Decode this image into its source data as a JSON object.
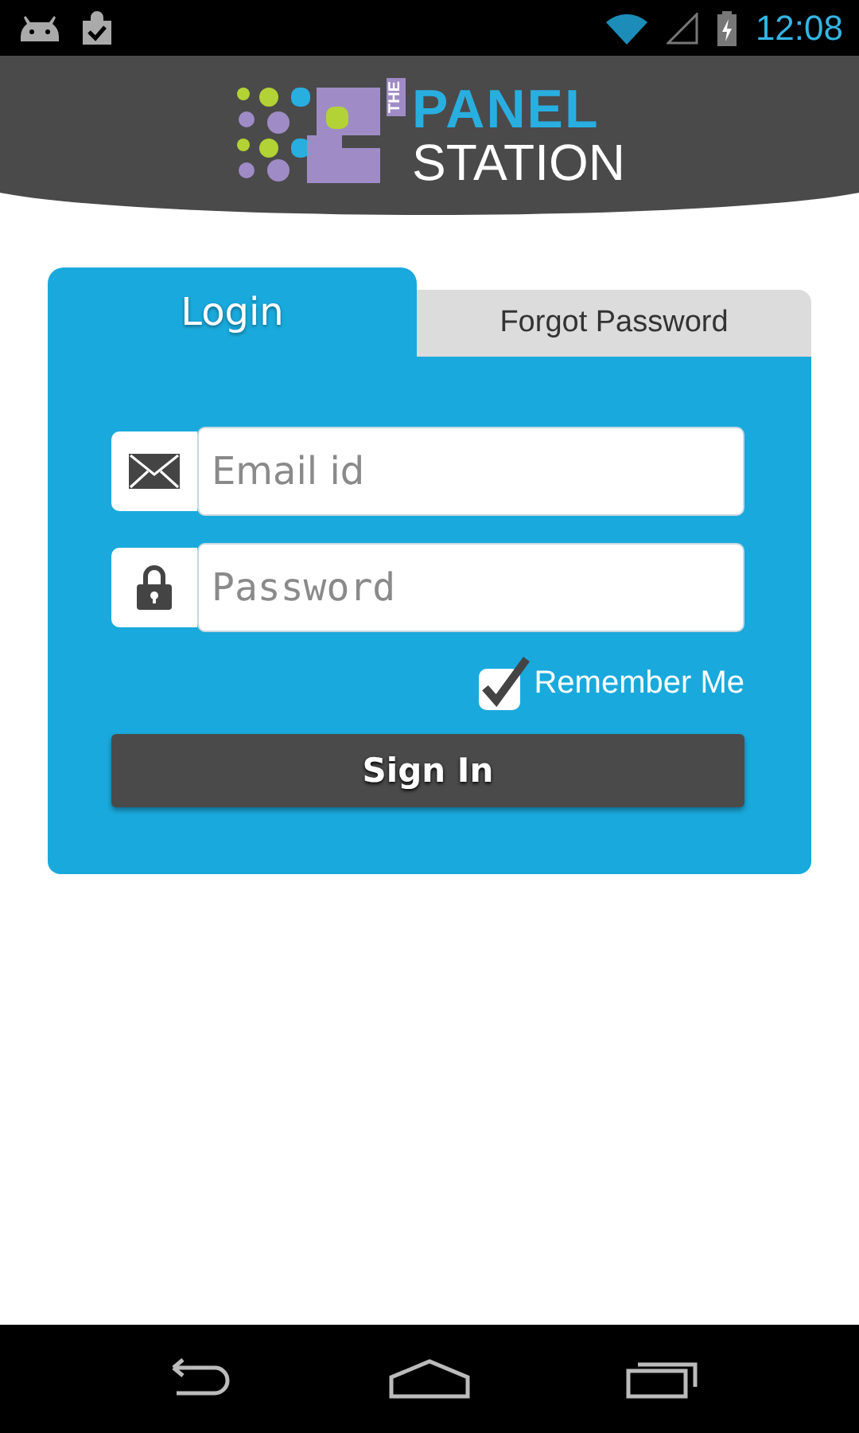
{
  "status_bar": {
    "time": "12:08"
  },
  "logo": {
    "small": "THE",
    "top": "PANEL",
    "bottom": "STATION"
  },
  "tabs": [
    {
      "label": "Login",
      "selected": true
    },
    {
      "label": "Forgot Password",
      "selected": false
    }
  ],
  "fields": [
    {
      "kind": "email",
      "placeholder": "Email id"
    },
    {
      "kind": "password",
      "placeholder": "Password"
    }
  ],
  "remember": {
    "label": "Remember Me",
    "checked": true
  },
  "sign_in": "Sign In"
}
